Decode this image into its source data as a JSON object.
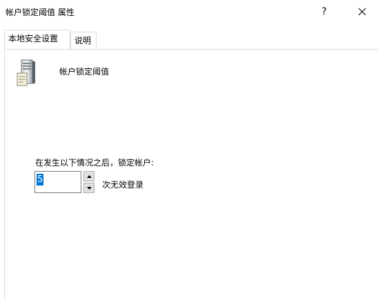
{
  "window": {
    "title": "帐户锁定阈值 属性",
    "help_label": "?",
    "close_icon": "close-icon"
  },
  "tabs": [
    {
      "label": "本地安全设置",
      "selected": true
    },
    {
      "label": "说明",
      "selected": false
    }
  ],
  "policy": {
    "icon": "server-policy-icon",
    "name": "帐户锁定阈值"
  },
  "lockout": {
    "instruction": "在发生以下情况之后，锁定帐户:",
    "threshold_value": "5",
    "unit_label": "次无效登录"
  },
  "colors": {
    "selection": "#0078d7",
    "border": "#d9d9d9"
  }
}
